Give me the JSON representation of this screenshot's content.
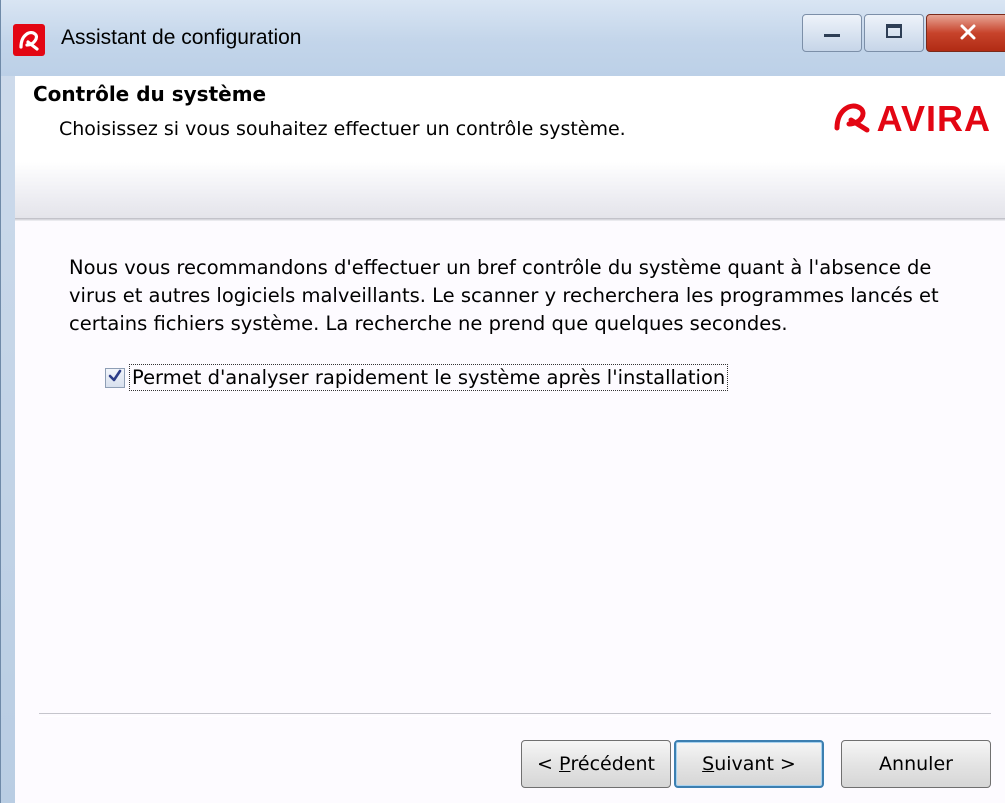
{
  "window": {
    "title": "Assistant de configuration",
    "minimize_glyph": "▭",
    "maximize_glyph": "◻",
    "close_glyph": "✕"
  },
  "header": {
    "title": "Contrôle du système",
    "subtitle": "Choisissez si vous souhaitez effectuer un contrôle système.",
    "logo_text": "AVIRA"
  },
  "content": {
    "description": "Nous vous recommandons d'effectuer un bref contrôle du système quant à l'absence de virus et autres logiciels malveillants. Le scanner y recherchera les programmes lancés et certains fichiers système. La recherche ne prend que quelques secondes.",
    "checkbox_label": "Permet d'analyser rapidement le système après l'installation",
    "checkbox_checked": true
  },
  "buttons": {
    "back_prefix": "< ",
    "back_accel": "P",
    "back_rest": "récédent",
    "next_accel": "S",
    "next_rest": "uivant >",
    "cancel": "Annuler"
  },
  "colors": {
    "brand": "#e30613",
    "titlebar": "#c3d5ea",
    "default_button_border": "#3c7fb1"
  },
  "icons": {
    "app": "avira-logo-icon",
    "minimize": "minimize-icon",
    "maximize": "maximize-icon",
    "close": "close-icon",
    "checkbox": "checkmark-icon"
  }
}
